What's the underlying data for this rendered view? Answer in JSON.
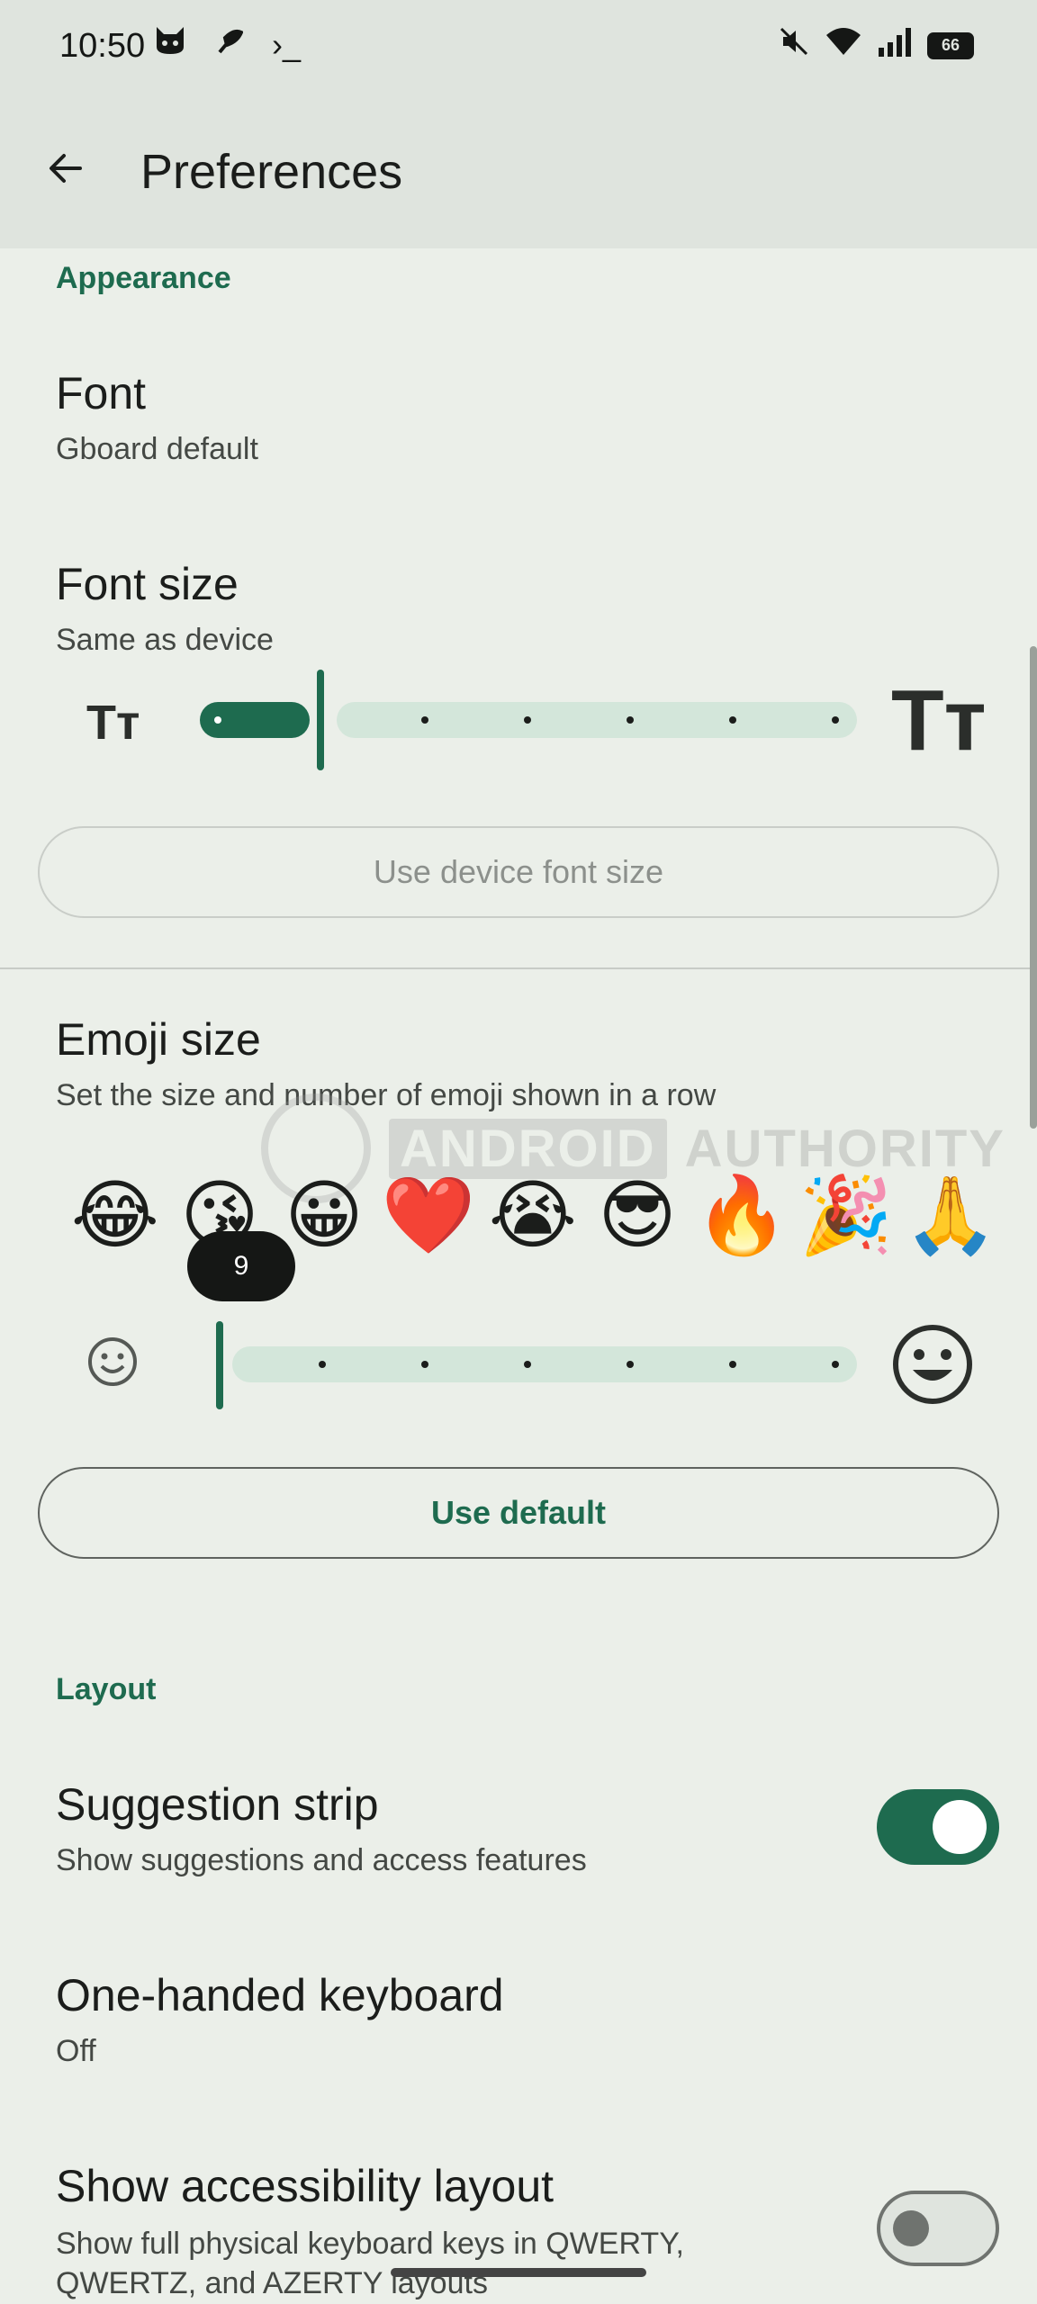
{
  "status": {
    "time": "10:50",
    "left_icons": [
      "cat-icon",
      "feather-icon",
      "terminal-icon"
    ],
    "terminal_glyph": "›_",
    "right_icons": [
      "mute-icon",
      "wifi-icon",
      "signal-icon"
    ],
    "battery": "66"
  },
  "header": {
    "title": "Preferences"
  },
  "appearance": {
    "section_label": "Appearance",
    "font": {
      "title": "Font",
      "subtitle": "Gboard default"
    },
    "font_size": {
      "title": "Font size",
      "subtitle": "Same as device",
      "small_glyph": "Tт",
      "large_glyph": "Tт",
      "slider_value_fraction": 0.17,
      "button": "Use device font size"
    },
    "emoji_size": {
      "title": "Emoji size",
      "subtitle": "Set the size and number of emoji shown in a row",
      "emojis": [
        "😂",
        "😘",
        "😀",
        "❤️",
        "😭",
        "😎",
        "🔥",
        "🎉",
        "🙏"
      ],
      "tooltip": "9",
      "small_glyph": "☺",
      "large_glyph": "☺",
      "slider_value_fraction": 0.0,
      "button": "Use default"
    }
  },
  "watermark": {
    "brand_a": "ANDROID",
    "brand_b": "AUTHORITY"
  },
  "layout": {
    "section_label": "Layout",
    "suggestion_strip": {
      "title": "Suggestion strip",
      "subtitle": "Show suggestions and access features",
      "enabled": true
    },
    "one_handed": {
      "title": "One-handed keyboard",
      "subtitle": "Off"
    },
    "accessibility": {
      "title": "Show accessibility layout",
      "subtitle_line1": "Show full physical keyboard keys in QWERTY,",
      "subtitle_line2": "QWERTZ, and AZERTY layouts",
      "enabled": false
    }
  },
  "colors": {
    "accent": "#1e6b4f",
    "track": "#d3e6da",
    "background": "#ebefe9",
    "header": "#dfe4de"
  }
}
